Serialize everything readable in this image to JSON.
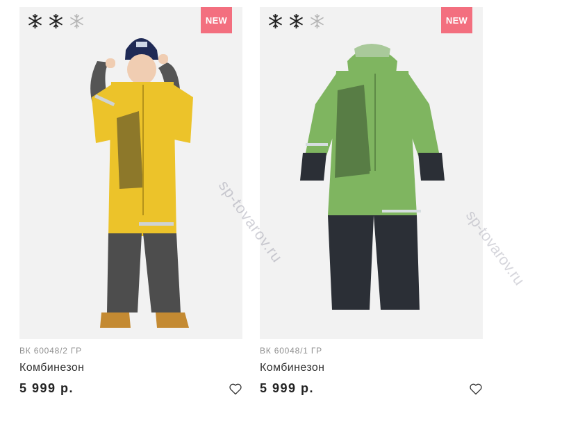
{
  "products": [
    {
      "badge": "NEW",
      "sku": "ВК 60048/2 ГР",
      "name": "Комбинезон",
      "price": "5 999 р.",
      "snowflakes": {
        "active": 2,
        "total": 3
      },
      "image": "child-in-yellow-snowsuit",
      "colors": {
        "suit": "#ecc32a",
        "pants": "#4d4d4d"
      }
    },
    {
      "badge": "NEW",
      "sku": "ВК 60048/1 ГР",
      "name": "Комбинезон",
      "price": "5 999 р.",
      "snowflakes": {
        "active": 2,
        "total": 3
      },
      "image": "green-snowsuit-flat",
      "colors": {
        "suit": "#7fb560",
        "pants": "#2b2f36"
      }
    }
  ],
  "watermark": "sp-tovarov.ru",
  "icons": {
    "snow": "snowflake-icon",
    "wishlist": "heart-icon"
  },
  "accent": "#f36f7f"
}
